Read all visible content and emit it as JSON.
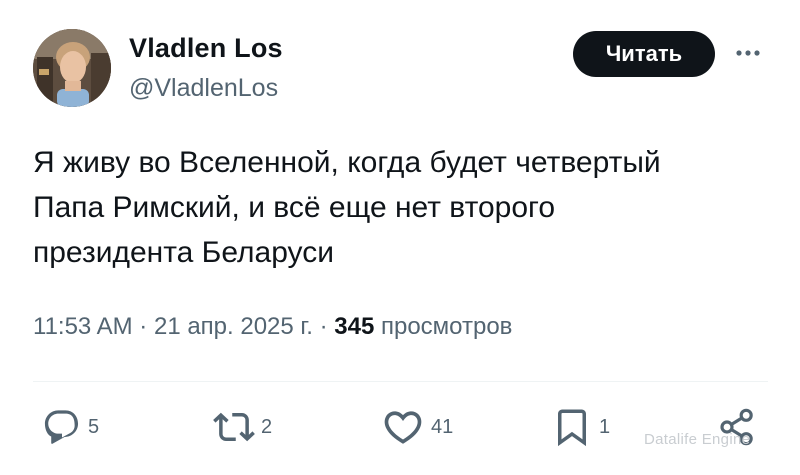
{
  "author": {
    "display_name": "Vladlen Los",
    "handle": "@VladlenLos"
  },
  "header": {
    "follow_label": "Читать",
    "more_icon": "more-icon"
  },
  "tweet": {
    "lines": [
      "Я живу во Вселенной, когда будет четвертый",
      "Папа Римский, и всё еще нет второго",
      "президента Беларуси"
    ]
  },
  "meta": {
    "time": "11:53 AM",
    "separator": "·",
    "date": "21 апр. 2025 г.",
    "views_count": "345",
    "views_label": "просмотров"
  },
  "actions": {
    "replies": "5",
    "retweets": "2",
    "likes": "41",
    "bookmarks": "1"
  },
  "watermark": "Datalife Engine",
  "colors": {
    "text_primary": "#0f1419",
    "text_secondary": "#536471",
    "divider": "#eff3f4",
    "button_bg": "#0f1419"
  }
}
